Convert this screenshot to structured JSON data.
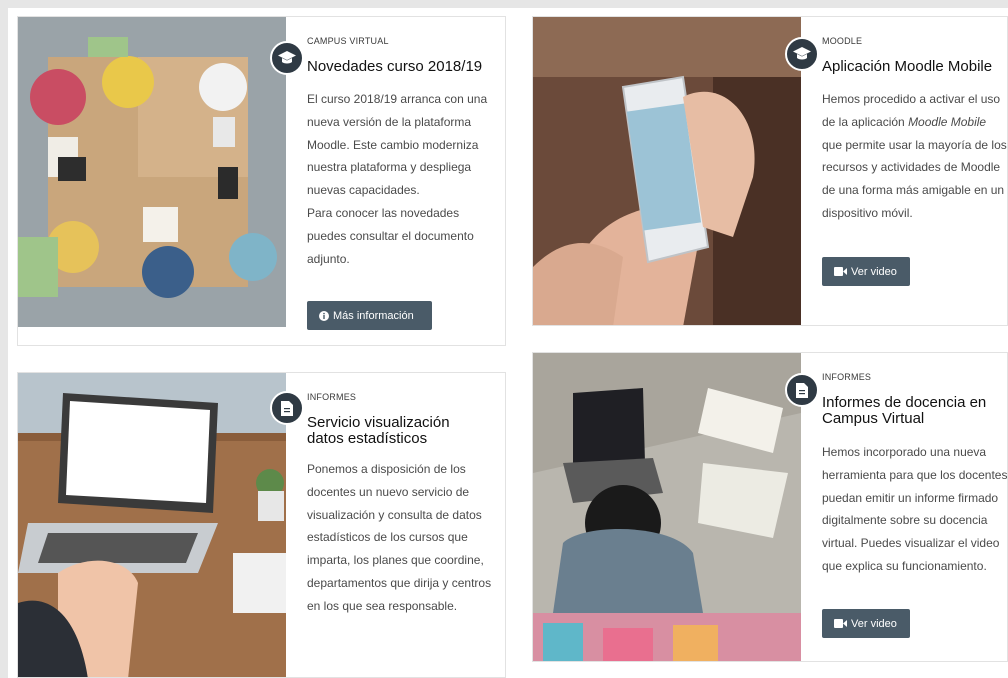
{
  "cards": [
    {
      "category": "CAMPUS VIRTUAL",
      "title": "Novedades curso 2018/19",
      "icon": "graduation-cap-icon",
      "paragraphs": [
        "El curso 2018/19 arranca con una nueva versión de la plataforma Moodle. Este cambio moderniza nuestra plataforma y despliega nuevas capacidades.",
        "Para conocer las novedades puedes consultar el documento adjunto."
      ],
      "button": {
        "label": "Más información",
        "icon": "info-circle-icon"
      }
    },
    {
      "category": "MOODLE",
      "title": "Aplicación Moodle Mobile",
      "icon": "graduation-cap-icon",
      "text_before": "Hemos procedido a activar el uso de la aplicación ",
      "text_em": "Moodle Mobile",
      "text_after": " que permite usar la mayoría de los recursos y actividades de Moodle de una forma más amigable en un dispositivo móvil.",
      "button": {
        "label": "Ver video",
        "icon": "video-camera-icon"
      }
    },
    {
      "category": "INFORMES",
      "title_line1": "Servicio visualización",
      "title_line2": "datos estadísticos",
      "icon": "document-icon",
      "paragraph": "Ponemos a disposición de los docentes un nuevo servicio de visualización y consulta de datos estadísticos de los cursos que imparta, los planes que coordine, departamentos que dirija y centros en los que sea responsable."
    },
    {
      "category": "INFORMES",
      "title_line1": "Informes de docencia en",
      "title_line2": "Campus Virtual",
      "icon": "document-icon",
      "paragraph": "Hemos incorporado una nueva herramienta para que los docentes puedan emitir un informe firmado digitalmente sobre su docencia virtual. Puedes visualizar el video que explica su funcionamiento.",
      "button": {
        "label": "Ver video",
        "icon": "video-camera-icon"
      }
    }
  ]
}
